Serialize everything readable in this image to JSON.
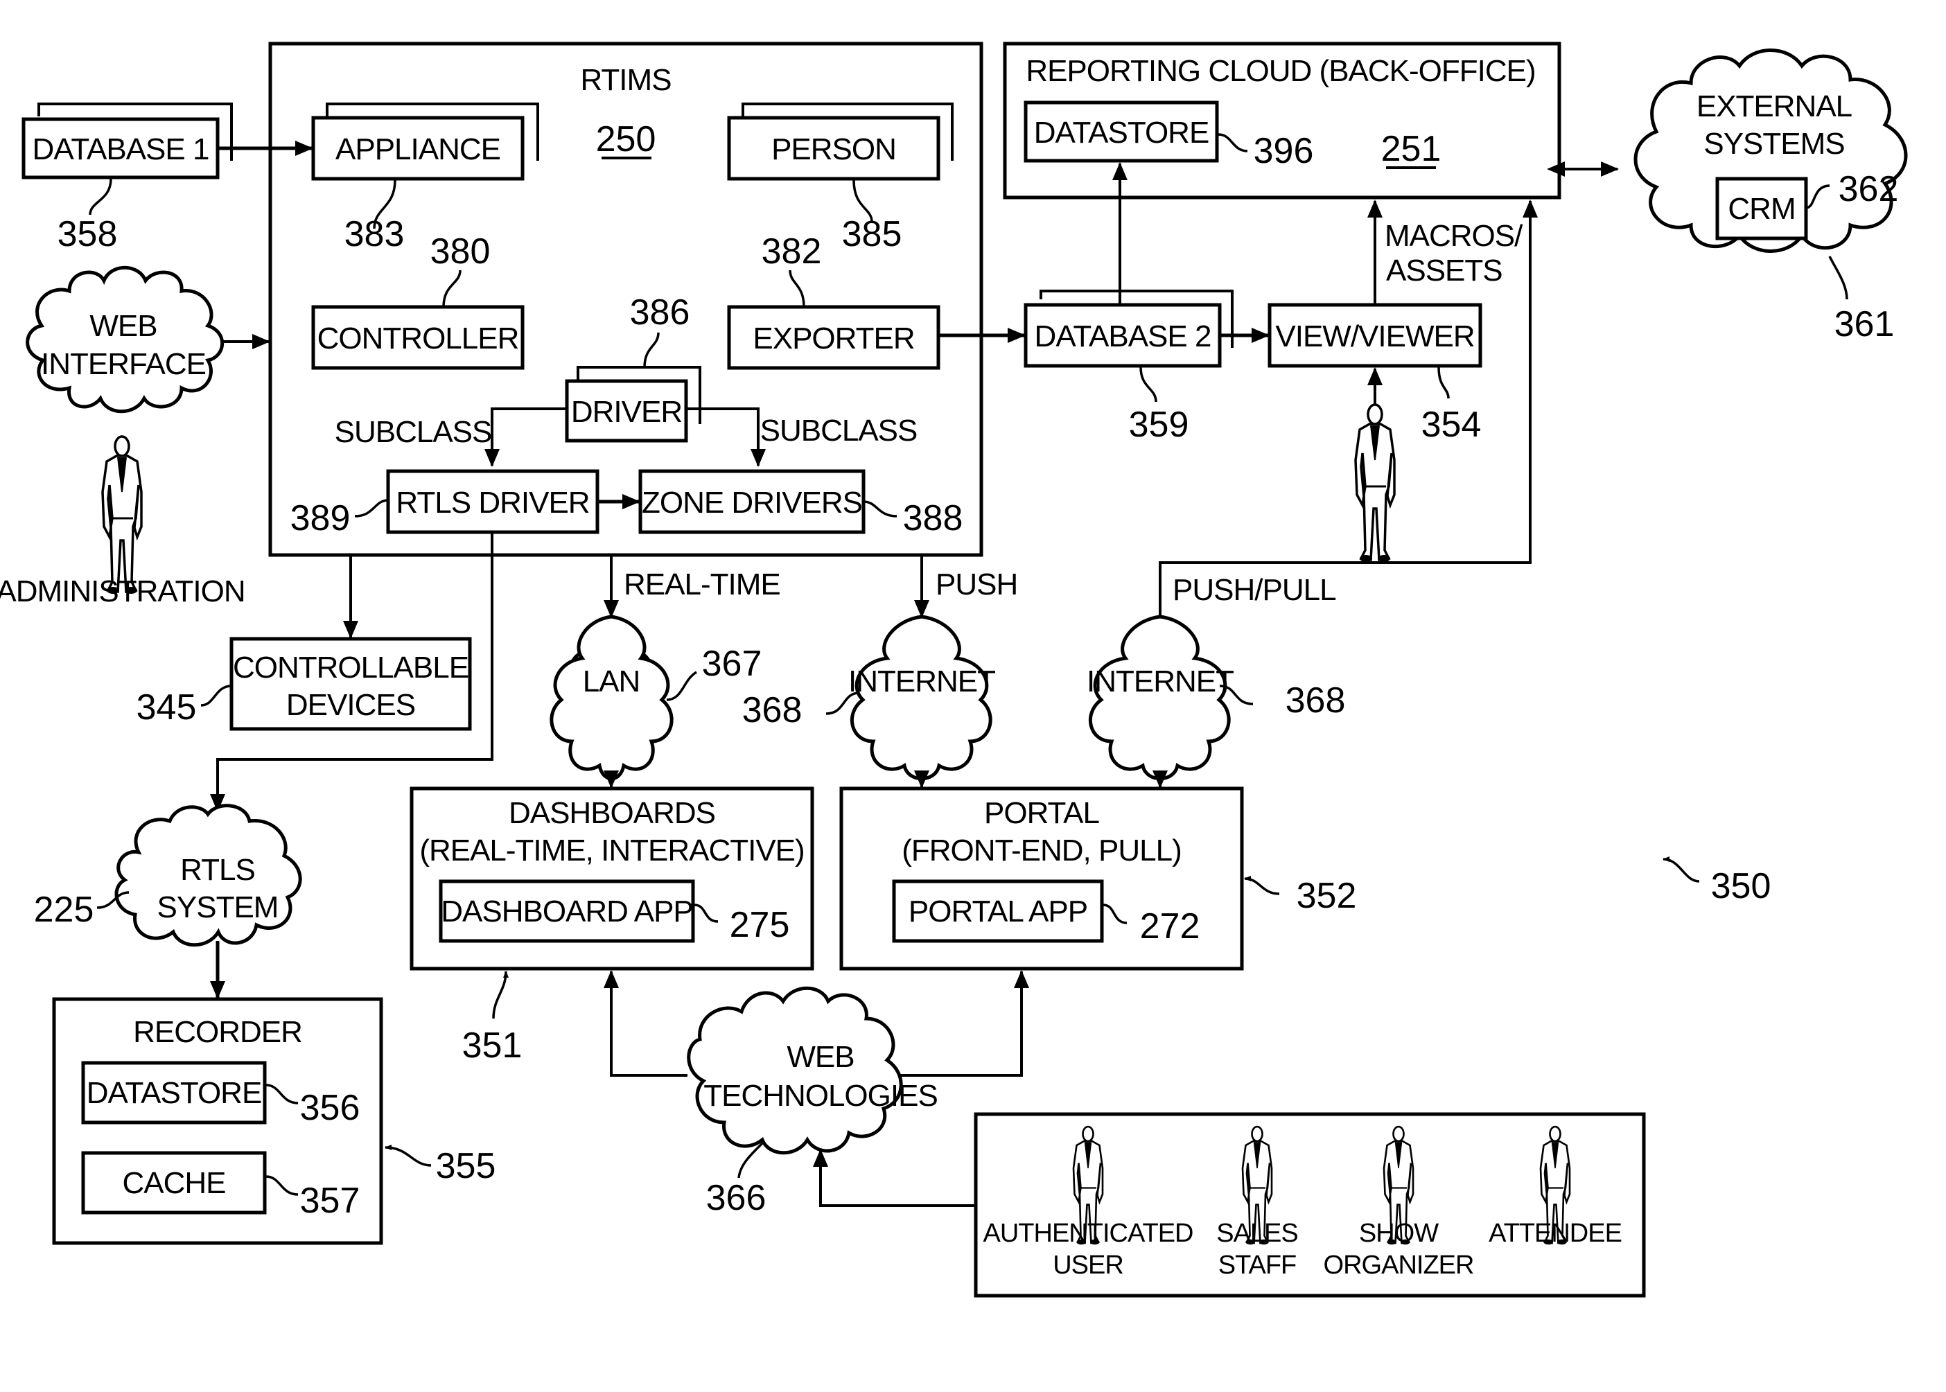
{
  "figure_number": "350",
  "colors": {
    "ink": "#000000",
    "paper": "#ffffff"
  },
  "rtims": {
    "title": "RTIMS",
    "ref": "250",
    "appliance": {
      "label": "APPLIANCE",
      "ref": "383"
    },
    "person": {
      "label": "PERSON",
      "ref": "385"
    },
    "controller": {
      "label": "CONTROLLER",
      "ref": "380"
    },
    "exporter": {
      "label": "EXPORTER",
      "ref": "382"
    },
    "driver": {
      "label": "DRIVER",
      "ref": "386"
    },
    "rtls_driver": {
      "label": "RTLS DRIVER",
      "ref": "389"
    },
    "zone_drivers": {
      "label": "ZONE DRIVERS",
      "ref": "388"
    },
    "subclass_left": "SUBCLASS",
    "subclass_right": "SUBCLASS"
  },
  "database1": {
    "label": "DATABASE 1",
    "ref": "358"
  },
  "web_interface": {
    "line1": "WEB",
    "line2": "INTERFACE"
  },
  "administration": {
    "label": "ADMINISTRATION"
  },
  "reporting_cloud": {
    "title": "REPORTING CLOUD (BACK-OFFICE)",
    "ref": "251",
    "datastore": {
      "label": "DATASTORE",
      "ref": "396"
    }
  },
  "external_systems": {
    "line1": "EXTERNAL",
    "line2": "SYSTEMS",
    "ref": "361",
    "crm": {
      "label": "CRM",
      "ref": "362"
    }
  },
  "database2": {
    "label": "DATABASE 2",
    "ref": "359"
  },
  "viewer": {
    "label": "VIEW/VIEWER",
    "ref": "354"
  },
  "macros_assets": {
    "line1": "MACROS/",
    "line2": "ASSETS"
  },
  "flow_labels": {
    "real_time": "REAL-TIME",
    "push": "PUSH",
    "push_pull": "PUSH/PULL"
  },
  "controllable_devices": {
    "line1": "CONTROLLABLE",
    "line2": "DEVICES",
    "ref": "345"
  },
  "lan": {
    "label": "LAN",
    "ref": "367"
  },
  "internet_left": {
    "label": "INTERNET",
    "ref": "368"
  },
  "internet_right": {
    "label": "INTERNET",
    "ref": "368"
  },
  "dashboards": {
    "line1": "DASHBOARDS",
    "line2": "(REAL-TIME, INTERACTIVE)",
    "ref": "351",
    "app": {
      "label": "DASHBOARD APP",
      "ref": "275"
    }
  },
  "portal": {
    "line1": "PORTAL",
    "line2": "(FRONT-END, PULL)",
    "ref": "352",
    "app": {
      "label": "PORTAL APP",
      "ref": "272"
    }
  },
  "rtls_system": {
    "line1": "RTLS",
    "line2": "SYSTEM",
    "ref": "225"
  },
  "recorder": {
    "title": "RECORDER",
    "ref": "355",
    "datastore": {
      "label": "DATASTORE",
      "ref": "356"
    },
    "cache": {
      "label": "CACHE",
      "ref": "357"
    }
  },
  "web_technologies": {
    "line1": "WEB",
    "line2": "TECHNOLOGIES",
    "ref": "366"
  },
  "users": [
    {
      "line1": "AUTHENTICATED",
      "line2": "USER"
    },
    {
      "line1": "SALES",
      "line2": "STAFF"
    },
    {
      "line1": "SHOW",
      "line2": "ORGANIZER"
    },
    {
      "line1": "ATTENDEE",
      "line2": ""
    }
  ]
}
